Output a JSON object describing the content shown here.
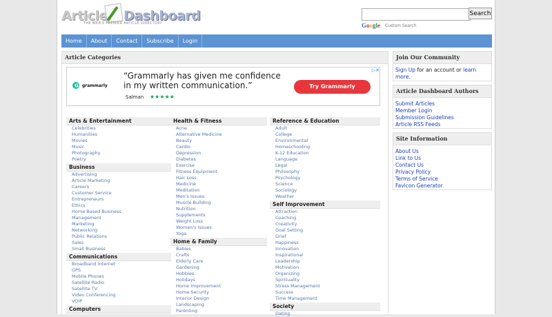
{
  "header": {
    "logo": {
      "word1": "Article",
      "word2": "Dashboard",
      "tagline": "THE WEB'S PREMIER ARTICLE DIRECTORY"
    },
    "search": {
      "placeholder": "",
      "button": "Search",
      "google_label": [
        "G",
        "o",
        "o",
        "g",
        "l",
        "e"
      ],
      "custom_search": "Custom Search"
    }
  },
  "nav": [
    "Home",
    "About",
    "Contact",
    "Subscribe",
    "Login"
  ],
  "main": {
    "title": "Article Categories",
    "ad": {
      "brand": "grammarly",
      "quote": "“Grammarly has given me confidence in my written communication.”",
      "author": "Salman",
      "stars": "★★★★★",
      "cta": "Try Grammarly",
      "adchoices": "▷✕"
    },
    "columns": [
      [
        {
          "name": "Arts & Entertainment",
          "subs": [
            "Celebrities",
            "Humanities",
            "Movies",
            "Music",
            "Photography",
            "Poetry"
          ]
        },
        {
          "name": "Business",
          "subs": [
            "Advertising",
            "Article Marketing",
            "Careers",
            "Customer Service",
            "Entrepreneurs",
            "Ethics",
            "Home Based Business",
            "Management",
            "Marketing",
            "Networking",
            "Public Relations",
            "Sales",
            "Small Business"
          ]
        },
        {
          "name": "Communications",
          "subs": [
            "Broadband Internet",
            "GPS",
            "Mobile Phones",
            "Satellite Radio",
            "Satellite TV",
            "Video Conferencing",
            "VOIP"
          ]
        },
        {
          "name": "Computers",
          "subs": []
        }
      ],
      [
        {
          "name": "Health & Fitness",
          "subs": [
            "Acne",
            "Alternative Medicine",
            "Beauty",
            "Cardio",
            "Depression",
            "Diabetes",
            "Exercise",
            "Fitness Equipment",
            "Hair Loss",
            "Medicine",
            "Meditation",
            "Men's Issues",
            "Muscle Building",
            "Nutrition",
            "Supplements",
            "Weight Loss",
            "Women's Issues",
            "Yoga"
          ]
        },
        {
          "name": "Home & Family",
          "subs": [
            "Babies",
            "Crafts",
            "Elderly Care",
            "Gardening",
            "Hobbies",
            "Holidays",
            "Home Improvement",
            "Home Security",
            "Interior Design",
            "Landscaping",
            "Parenting"
          ]
        }
      ],
      [
        {
          "name": "Reference & Education",
          "subs": [
            "Adult",
            "College",
            "Environmental",
            "Homeschooling",
            "K-12 Education",
            "Language",
            "Legal",
            "Philosophy",
            "Psychology",
            "Science",
            "Sociology",
            "Weather"
          ]
        },
        {
          "name": "Self Improvement",
          "subs": [
            "Attraction",
            "Coaching",
            "Creativity",
            "Goal Setting",
            "Grief",
            "Happiness",
            "Innovation",
            "Inspirational",
            "Leadership",
            "Motivation",
            "Organizing",
            "Spirituality",
            "Stress Management",
            "Success",
            "Time Management"
          ]
        },
        {
          "name": "Society",
          "subs": [
            "Dating"
          ]
        }
      ]
    ]
  },
  "sidebar": {
    "community": {
      "title": "Join Our Community",
      "signup": "Sign Up",
      "middle": " for an account or ",
      "learn": "learn more."
    },
    "authors": {
      "title": "Article Dashboard Authors",
      "links": [
        "Submit Articles",
        "Member Login",
        "Submission Guidelines",
        "Article RSS Feeds"
      ]
    },
    "site": {
      "title": "Site Information",
      "links": [
        "About Us",
        "Link to Us",
        "Contact Us",
        "Privacy Policy",
        "Terms of Service",
        "Favicon Generator"
      ]
    }
  },
  "colors": {
    "nav": "#5b93d3",
    "link": "#1a3fb5",
    "sublink": "#5577aa",
    "cta": "#e8363d"
  }
}
